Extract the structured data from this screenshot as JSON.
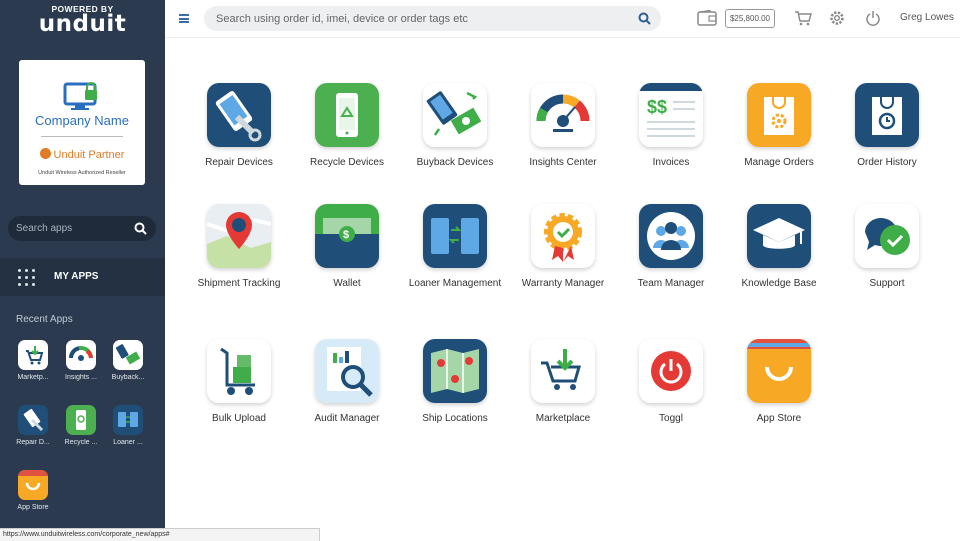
{
  "sidebar": {
    "powered_by": "POWERED BY",
    "brand": "unduit",
    "company_card": {
      "company_name": "Company Name",
      "partner": "Unduit Partner",
      "reseller": "Unduit Wireless Authorized Reseller"
    },
    "search_placeholder": "Search apps",
    "my_apps_label": "MY APPS",
    "recent_title": "Recent Apps",
    "recent_apps": [
      {
        "label": "Marketp...",
        "icon": "marketplace-icon"
      },
      {
        "label": "Insights ...",
        "icon": "insights-icon"
      },
      {
        "label": "Buyback...",
        "icon": "buyback-icon"
      },
      {
        "label": "Repair D...",
        "icon": "repair-icon"
      },
      {
        "label": "Recycle ...",
        "icon": "recycle-icon"
      },
      {
        "label": "Loaner ...",
        "icon": "loaner-icon"
      },
      {
        "label": "App Store",
        "icon": "app-store-icon"
      }
    ]
  },
  "topbar": {
    "search_placeholder": "Search using order id, imei, device or order tags etc",
    "balance": "$25,800.00",
    "username": "Greg Lowes"
  },
  "apps": [
    {
      "label": "Repair Devices",
      "icon": "repair-icon"
    },
    {
      "label": "Recycle Devices",
      "icon": "recycle-icon"
    },
    {
      "label": "Buyback Devices",
      "icon": "buyback-icon"
    },
    {
      "label": "Insights Center",
      "icon": "insights-icon"
    },
    {
      "label": "Invoices",
      "icon": "invoice-icon"
    },
    {
      "label": "Manage Orders",
      "icon": "manage-orders-icon"
    },
    {
      "label": "Order History",
      "icon": "order-history-icon"
    },
    {
      "label": "Shipment Tracking",
      "icon": "shipment-tracking-icon"
    },
    {
      "label": "Wallet",
      "icon": "wallet-icon"
    },
    {
      "label": "Loaner Management",
      "icon": "loaner-icon"
    },
    {
      "label": "Warranty Manager",
      "icon": "warranty-icon"
    },
    {
      "label": "Team Manager",
      "icon": "team-icon"
    },
    {
      "label": "Knowledge Base",
      "icon": "knowledge-base-icon"
    },
    {
      "label": "Support",
      "icon": "support-icon"
    },
    {
      "label": "Bulk Upload",
      "icon": "bulk-upload-icon"
    },
    {
      "label": "Audit Manager",
      "icon": "audit-icon"
    },
    {
      "label": "Ship Locations",
      "icon": "ship-locations-icon"
    },
    {
      "label": "Marketplace",
      "icon": "marketplace-icon"
    },
    {
      "label": "Toggl",
      "icon": "toggl-icon"
    },
    {
      "label": "App Store",
      "icon": "app-store-icon"
    }
  ],
  "status_url": "https://www.unduitwireless.com/corporate_new/apps#",
  "colors": {
    "sidebar": "#2b3a4e",
    "navy": "#1f4e79",
    "green": "#4caf50",
    "orange": "#f7a825",
    "red": "#e53935"
  }
}
